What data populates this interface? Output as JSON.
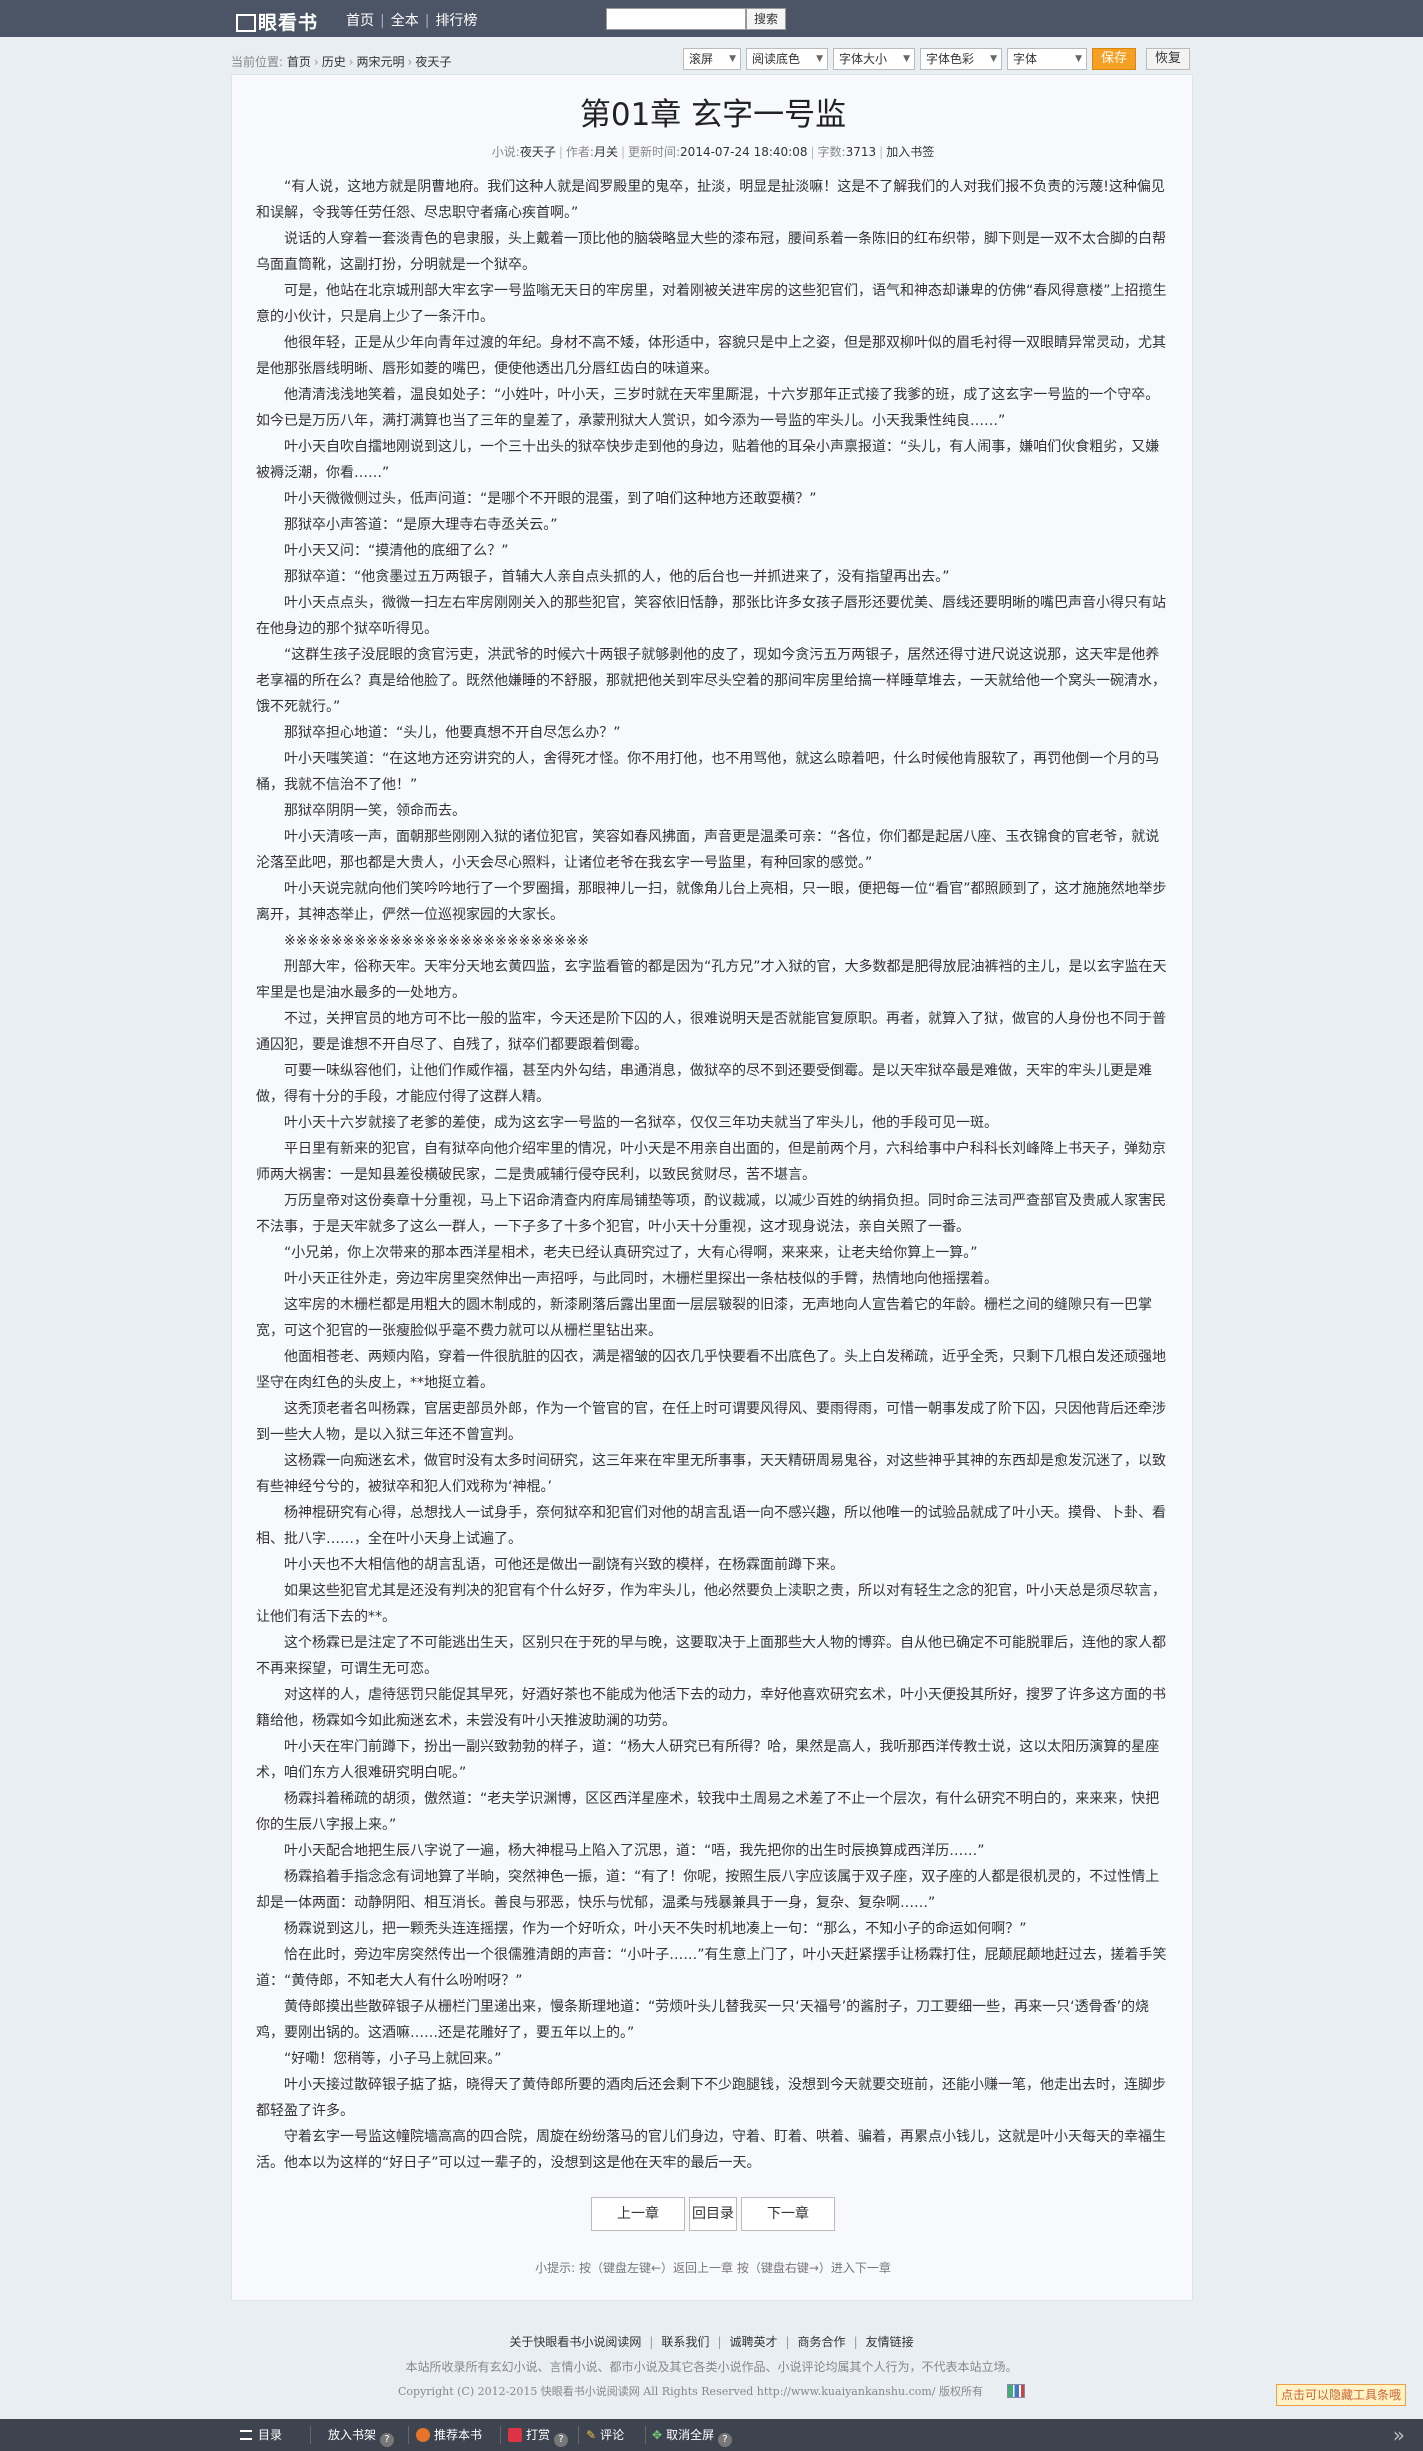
{
  "topbar": {
    "logo_text": "眼看书",
    "nav": [
      "首页",
      "全本",
      "排行榜"
    ],
    "search_button": "搜索"
  },
  "breadcrumb": {
    "label": "当前位置:",
    "home": "首页",
    "category": "历史",
    "subcategory": "两宋元明",
    "book": "夜天子"
  },
  "toolbar": {
    "scroll": "滚屏",
    "background": "阅读底色",
    "font_size": "字体大小",
    "font_color": "字体色彩",
    "font": "字体",
    "save": "保存",
    "restore": "恢复"
  },
  "chapter": {
    "title": "第01章 玄字一号监"
  },
  "meta": {
    "novel_label": "小说:",
    "novel": "夜天子",
    "author_label": "作者:",
    "author": "月关",
    "updated_label": "更新时间:",
    "updated": "2014-07-24 18:40:08",
    "words_label": "字数:",
    "words": "3713",
    "bookmark": "加入书签"
  },
  "paragraphs": [
    "“有人说，这地方就是阴曹地府。我们这种人就是阎罗殿里的鬼卒，扯淡，明显是扯淡嘛！这是不了解我们的人对我们报不负责的污蔑!这种偏见和误解，令我等任劳任怨、尽忠职守者痛心疾首啊。”",
    "说话的人穿着一套淡青色的皂隶服，头上戴着一顶比他的脑袋略显大些的漆布冠，腰间系着一条陈旧的红布织带，脚下则是一双不太合脚的白帮乌面直筒靴，这副打扮，分明就是一个狱卒。",
    "可是，他站在北京城刑部大牢玄字一号监嗡无天日的牢房里，对着刚被关进牢房的这些犯官们，语气和神态却谦卑的仿佛“春风得意楼”上招揽生意的小伙计，只是肩上少了一条汗巾。",
    "他很年轻，正是从少年向青年过渡的年纪。身材不高不矮，体形适中，容貌只是中上之姿，但是那双柳叶似的眉毛衬得一双眼睛异常灵动，尤其是他那张唇线明晰、唇形如菱的嘴巴，便使他透出几分唇红齿白的味道来。",
    "他清清浅浅地笑着，温良如处子：“小姓叶，叶小天，三岁时就在天牢里厮混，十六岁那年正式接了我爹的班，成了这玄字一号监的一个守卒。如今已是万历八年，满打满算也当了三年的皇差了，承蒙刑狱大人赏识，如今添为一号监的牢头儿。小天我秉性纯良……”",
    "叶小天自吹自擂地刚说到这儿，一个三十出头的狱卒快步走到他的身边，贴着他的耳朵小声禀报道：“头儿，有人闹事，嫌咱们伙食粗劣，又嫌被褥泛潮，你看……”",
    "叶小天微微侧过头，低声问道：“是哪个不开眼的混蛋，到了咱们这种地方还敢耍横？”",
    "那狱卒小声答道：“是原大理寺右寺丞关云。”",
    "叶小天又问：“摸清他的底细了么？”",
    "那狱卒道：“他贪墨过五万两银子，首辅大人亲自点头抓的人，他的后台也一并抓进来了，没有指望再出去。”",
    "叶小天点点头，微微一扫左右牢房刚刚关入的那些犯官，笑容依旧恬静，那张比许多女孩子唇形还要优美、唇线还要明晰的嘴巴声音小得只有站在他身边的那个狱卒听得见。",
    "“这群生孩子没屁眼的贪官污吏，洪武爷的时候六十两银子就够剥他的皮了，现如今贪污五万两银子，居然还得寸进尺说这说那，这天牢是他养老享福的所在么？真是给他脸了。既然他嫌睡的不舒服，那就把他关到牢尽头空着的那间牢房里给搞一样睡草堆去，一天就给他一个窝头一碗清水，饿不死就行。”",
    "那狱卒担心地道：“头儿，他要真想不开自尽怎么办？”",
    "叶小天嗤笑道：“在这地方还穷讲究的人，舍得死才怪。你不用打他，也不用骂他，就这么晾着吧，什么时候他肯服软了，再罚他倒一个月的马桶，我就不信治不了他！”",
    "那狱卒阴阴一笑，领命而去。",
    "叶小天清咳一声，面朝那些刚刚入狱的诸位犯官，笑容如春风拂面，声音更是温柔可亲：“各位，你们都是起居八座、玉衣锦食的官老爷，就说沦落至此吧，那也都是大贵人，小天会尽心照料，让诸位老爷在我玄字一号监里，有种回家的感觉。”",
    "叶小天说完就向他们笑吟吟地行了一个罗圈揖，那眼神儿一扫，就像角儿台上亮相，只一眼，便把每一位“看官”都照顾到了，这才施施然地举步离开，其神态举止，俨然一位巡视家园的大家长。",
    "※※※※※※※※※※※※※※※※※※※※※※※※※※",
    "刑部大牢，俗称天牢。天牢分天地玄黄四监，玄字监看管的都是因为“孔方兄”才入狱的官，大多数都是肥得放屁油裤裆的主儿，是以玄字监在天牢里是也是油水最多的一处地方。",
    "不过，关押官员的地方可不比一般的监牢，今天还是阶下囚的人，很难说明天是否就能官复原职。再者，就算入了狱，做官的人身份也不同于普通囚犯，要是谁想不开自尽了、自残了，狱卒们都要跟着倒霉。",
    "可要一味纵容他们，让他们作威作福，甚至内外勾结，串通消息，做狱卒的尽不到还要受倒霉。是以天牢狱卒最是难做，天牢的牢头儿更是难做，得有十分的手段，才能应付得了这群人精。",
    "叶小天十六岁就接了老爹的差使，成为这玄字一号监的一名狱卒，仅仅三年功夫就当了牢头儿，他的手段可见一斑。",
    "平日里有新来的犯官，自有狱卒向他介绍牢里的情况，叶小天是不用亲自出面的，但是前两个月，六科给事中户科科长刘峰降上书天子，弹劾京师两大祸害：一是知县差役横破民家，二是贵戚辅行侵夺民利，以致民贫财尽，苦不堪言。",
    "万历皇帝对这份奏章十分重视，马上下诏命清查内府库局铺垫等项，酌议裁减，以减少百姓的纳捐负担。同时命三法司严查部官及贵戚人家害民不法事，于是天牢就多了这么一群人，一下子多了十多个犯官，叶小天十分重视，这才现身说法，亲自关照了一番。",
    "“小兄弟，你上次带来的那本西洋星相术，老夫已经认真研究过了，大有心得啊，来来来，让老夫给你算上一算。”",
    "叶小天正往外走，旁边牢房里突然伸出一声招呼，与此同时，木栅栏里探出一条枯枝似的手臂，热情地向他摇摆着。",
    "这牢房的木栅栏都是用粗大的圆木制成的，新漆刷落后露出里面一层层皲裂的旧漆，无声地向人宣告着它的年龄。栅栏之间的缝隙只有一巴掌宽，可这个犯官的一张瘦脸似乎毫不费力就可以从栅栏里钻出来。",
    "他面相苍老、两颊内陷，穿着一件很肮脏的囚衣，满是褶皱的囚衣几乎快要看不出底色了。头上白发稀疏，近乎全秃，只剩下几根白发还顽强地坚守在肉红色的头皮上，**地挺立着。",
    "这秃顶老者名叫杨霖，官居吏部员外郎，作为一个管官的官，在任上时可谓要风得风、要雨得雨，可惜一朝事发成了阶下囚，只因他背后还牵涉到一些大人物，是以入狱三年还不曾宣判。",
    "这杨霖一向痴迷玄术，做官时没有太多时间研究，这三年来在牢里无所事事，天天精研周易鬼谷，对这些神乎其神的东西却是愈发沉迷了，以致有些神经兮兮的，被狱卒和犯人们戏称为‘神棍。’",
    "杨神棍研究有心得，总想找人一试身手，奈何狱卒和犯官们对他的胡言乱语一向不感兴趣，所以他唯一的试验品就成了叶小天。摸骨、卜卦、看相、批八字……，全在叶小天身上试遍了。",
    "叶小天也不大相信他的胡言乱语，可他还是做出一副饶有兴致的模样，在杨霖面前蹲下来。",
    "如果这些犯官尤其是还没有判决的犯官有个什么好歹，作为牢头儿，他必然要负上渎职之责，所以对有轻生之念的犯官，叶小天总是须尽软言，让他们有活下去的**。",
    "这个杨霖已是注定了不可能逃出生天，区别只在于死的早与晚，这要取决于上面那些大人物的博弈。自从他已确定不可能脱罪后，连他的家人都不再来探望，可谓生无可恋。",
    "对这样的人，虐待惩罚只能促其早死，好酒好茶也不能成为他活下去的动力，幸好他喜欢研究玄术，叶小天便投其所好，搜罗了许多这方面的书籍给他，杨霖如今如此痴迷玄术，未尝没有叶小天推波助澜的功劳。",
    "叶小天在牢门前蹲下，扮出一副兴致勃勃的样子，道：“杨大人研究已有所得？哈，果然是高人，我听那西洋传教士说，这以太阳历演算的星座术，咱们东方人很难研究明白呢。”",
    "杨霖抖着稀疏的胡须，傲然道：“老夫学识渊博，区区西洋星座术，较我中土周易之术差了不止一个层次，有什么研究不明白的，来来来，快把你的生辰八字报上来。”",
    "叶小天配合地把生辰八字说了一遍，杨大神棍马上陷入了沉思，道：“唔，我先把你的出生时辰换算成西洋历……”",
    "杨霖掐着手指念念有词地算了半晌，突然神色一振，道：“有了！你呢，按照生辰八字应该属于双子座，双子座的人都是很机灵的，不过性情上却是一体两面：动静阴阳、相互消长。善良与邪恶，快乐与忧郁，温柔与残暴兼具于一身，复杂、复杂啊……”",
    "杨霖说到这儿，把一颗秃头连连摇摆，作为一个好听众，叶小天不失时机地凑上一句：“那么，不知小子的命运如何啊？”",
    "恰在此时，旁边牢房突然传出一个很儒雅清朗的声音：“小叶子……”有生意上门了，叶小天赶紧摆手让杨霖打住，屁颠屁颠地赶过去，搓着手笑道：“黄侍郎，不知老大人有什么吩咐呀？”",
    "黄侍郎摸出些散碎银子从栅栏门里递出来，慢条斯理地道：“劳烦叶头儿替我买一只‘天福号’的酱肘子，刀工要细一些，再来一只‘透骨香’的烧鸡，要刚出锅的。这酒嘛……还是花雕好了，要五年以上的。”",
    "“好嘞！您稍等，小子马上就回来。”",
    "叶小天接过散碎银子掂了掂，晓得天了黄侍郎所要的酒肉后还会剩下不少跑腿钱，没想到今天就要交班前，还能小赚一笔，他走出去时，连脚步都轻盈了许多。",
    "守着玄字一号监这幢院墙高高的四合院，周旋在纷纷落马的官儿们身边，守着、盯着、哄着、骗着，再累点小钱儿，这就是叶小天每天的幸福生活。他本以为这样的“好日子”可以过一辈子的，没想到这是他在天牢的最后一天。"
  ],
  "pager": {
    "prev": "上一章",
    "index": "回目录",
    "next": "下一章"
  },
  "tip": "小提示: 按（键盘左键←）返回上一章 按（键盘右键→）进入下一章",
  "footer": {
    "links": [
      "关于快眼看书小说阅读网",
      "联系我们",
      "诚聘英才",
      "商务合作",
      "友情链接"
    ],
    "disclaimer": "本站所收录所有玄幻小说、言情小说、都市小说及其它各类小说作品、小说评论均属其个人行为，不代表本站立场。",
    "copyright": "Copyright (C) 2012-2015 快眼看书小说阅读网 All Rights Reserved http://www.kuaiyankanshu.com/ 版权所有"
  },
  "float_tip": "点击可以隐藏工具条哦",
  "bottombar": {
    "items": [
      "目录",
      "放入书架",
      "推荐本书",
      "打赏",
      "评论",
      "取消全屏"
    ]
  }
}
